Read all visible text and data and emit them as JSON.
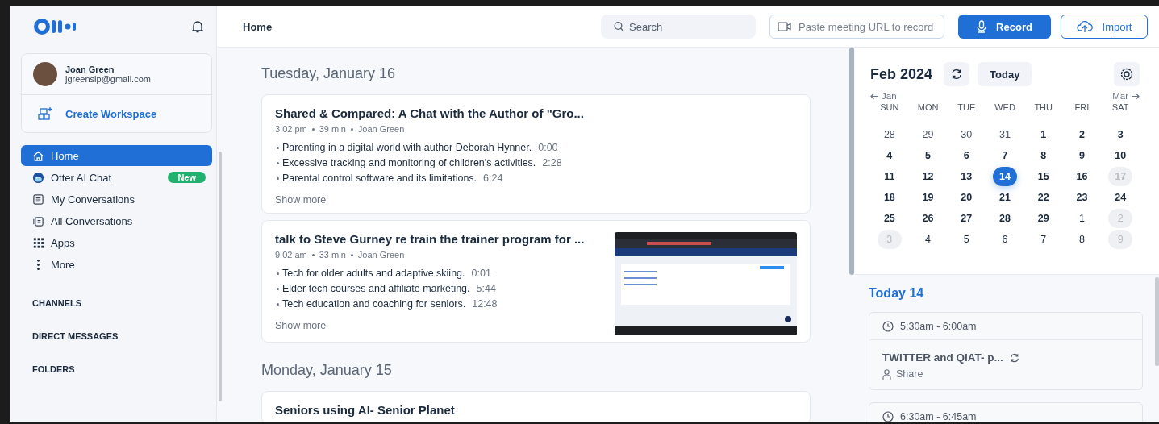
{
  "sidebar": {
    "user": {
      "name": "Joan Green",
      "email": "jgreenslp@gmail.com"
    },
    "create_workspace": "Create Workspace",
    "nav": [
      {
        "label": "Home",
        "kind": "home",
        "selected": true
      },
      {
        "label": "Otter AI Chat",
        "kind": "chat",
        "selected": false,
        "badge": "New"
      },
      {
        "label": "My Conversations",
        "kind": "conversations",
        "selected": false
      },
      {
        "label": "All Conversations",
        "kind": "all",
        "selected": false
      },
      {
        "label": "Apps",
        "kind": "apps",
        "selected": false
      },
      {
        "label": "More",
        "kind": "more",
        "selected": false
      }
    ],
    "sections": [
      "CHANNELS",
      "DIRECT MESSAGES",
      "FOLDERS"
    ]
  },
  "header": {
    "title": "Home",
    "search": {
      "placeholder": "Search"
    },
    "meeting_url": {
      "placeholder": "Paste meeting URL to record"
    },
    "record_button": "Record",
    "import_button": "Import"
  },
  "feed": [
    {
      "heading": "Tuesday, January 16",
      "conversations": [
        {
          "title": "Shared & Compared: A Chat with the Author of \"Gro...",
          "meta": [
            "3:02 pm",
            "39 min",
            "Joan Green"
          ],
          "outline": [
            {
              "text": "Parenting in a digital world with author Deborah Hynner.",
              "time": "0:00"
            },
            {
              "text": "Excessive tracking and monitoring of children's activities.",
              "time": "2:28"
            },
            {
              "text": "Parental control software and its limitations.",
              "time": "6:24"
            }
          ],
          "show_more": "Show more"
        },
        {
          "title": "talk to Steve Gurney re train the trainer program for ...",
          "meta": [
            "9:02 am",
            "33 min",
            "Joan Green"
          ],
          "outline": [
            {
              "text": "Tech for older adults and adaptive skiing.",
              "time": "0:01"
            },
            {
              "text": "Elder tech courses and affiliate marketing.",
              "time": "5:44"
            },
            {
              "text": "Tech education and coaching for seniors.",
              "time": "12:48"
            }
          ],
          "show_more": "Show more"
        }
      ]
    },
    {
      "heading": "Monday, January 15",
      "conversations": [
        {
          "title": "Seniors using AI- Senior Planet"
        }
      ]
    }
  ],
  "calendar": {
    "month": "Feb 2024",
    "today_button": "Today",
    "prev": "Jan",
    "next": "Mar",
    "weekdays": [
      "SUN",
      "MON",
      "TUE",
      "WED",
      "THU",
      "FRI",
      "SAT"
    ],
    "days": [
      {
        "label": "28",
        "kind": "other",
        "selected": false,
        "disabled": false
      },
      {
        "label": "29",
        "kind": "other",
        "selected": false,
        "disabled": false
      },
      {
        "label": "30",
        "kind": "other",
        "selected": false,
        "disabled": false
      },
      {
        "label": "31",
        "kind": "other",
        "selected": false,
        "disabled": false
      },
      {
        "label": "1",
        "kind": "current",
        "selected": false,
        "disabled": false
      },
      {
        "label": "2",
        "kind": "current",
        "selected": false,
        "disabled": false
      },
      {
        "label": "3",
        "kind": "current",
        "selected": false,
        "disabled": false
      },
      {
        "label": "4",
        "kind": "current",
        "selected": false,
        "disabled": false
      },
      {
        "label": "5",
        "kind": "current",
        "selected": false,
        "disabled": false
      },
      {
        "label": "6",
        "kind": "current",
        "selected": false,
        "disabled": false
      },
      {
        "label": "7",
        "kind": "current",
        "selected": false,
        "disabled": false
      },
      {
        "label": "8",
        "kind": "current",
        "selected": false,
        "disabled": false
      },
      {
        "label": "9",
        "kind": "current",
        "selected": false,
        "disabled": false
      },
      {
        "label": "10",
        "kind": "current",
        "selected": false,
        "disabled": false
      },
      {
        "label": "11",
        "kind": "current",
        "selected": false,
        "disabled": false
      },
      {
        "label": "12",
        "kind": "current",
        "selected": false,
        "disabled": false
      },
      {
        "label": "13",
        "kind": "current",
        "selected": false,
        "disabled": false
      },
      {
        "label": "14",
        "kind": "current",
        "selected": true,
        "disabled": false
      },
      {
        "label": "15",
        "kind": "current",
        "selected": false,
        "disabled": false
      },
      {
        "label": "16",
        "kind": "current",
        "selected": false,
        "disabled": false
      },
      {
        "label": "17",
        "kind": "current",
        "selected": false,
        "disabled": true
      },
      {
        "label": "18",
        "kind": "current",
        "selected": false,
        "disabled": false
      },
      {
        "label": "19",
        "kind": "current",
        "selected": false,
        "disabled": false
      },
      {
        "label": "20",
        "kind": "current",
        "selected": false,
        "disabled": false
      },
      {
        "label": "21",
        "kind": "current",
        "selected": false,
        "disabled": false
      },
      {
        "label": "22",
        "kind": "current",
        "selected": false,
        "disabled": false
      },
      {
        "label": "23",
        "kind": "current",
        "selected": false,
        "disabled": false
      },
      {
        "label": "24",
        "kind": "current",
        "selected": false,
        "disabled": false
      },
      {
        "label": "25",
        "kind": "current",
        "selected": false,
        "disabled": false
      },
      {
        "label": "26",
        "kind": "current",
        "selected": false,
        "disabled": false
      },
      {
        "label": "27",
        "kind": "current",
        "selected": false,
        "disabled": false
      },
      {
        "label": "28",
        "kind": "current",
        "selected": false,
        "disabled": false
      },
      {
        "label": "29",
        "kind": "current",
        "selected": false,
        "disabled": false
      },
      {
        "label": "1",
        "kind": "next",
        "selected": false,
        "disabled": false
      },
      {
        "label": "2",
        "kind": "next",
        "selected": false,
        "disabled": true
      },
      {
        "label": "3",
        "kind": "next",
        "selected": false,
        "disabled": true
      },
      {
        "label": "4",
        "kind": "next",
        "selected": false,
        "disabled": false
      },
      {
        "label": "5",
        "kind": "next",
        "selected": false,
        "disabled": false
      },
      {
        "label": "6",
        "kind": "next",
        "selected": false,
        "disabled": false
      },
      {
        "label": "7",
        "kind": "next",
        "selected": false,
        "disabled": false
      },
      {
        "label": "8",
        "kind": "next",
        "selected": false,
        "disabled": false
      },
      {
        "label": "9",
        "kind": "next",
        "selected": false,
        "disabled": true
      }
    ]
  },
  "agenda": {
    "heading": "Today 14",
    "events": [
      {
        "time": "5:30am - 6:00am",
        "title": "TWITTER and QIAT- p...",
        "recurring": true,
        "share": "Share"
      },
      {
        "time": "6:30am - 6:45am"
      }
    ]
  }
}
